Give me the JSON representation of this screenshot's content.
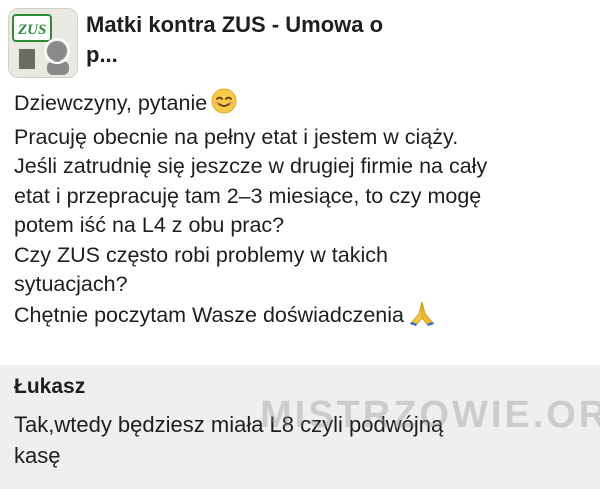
{
  "header": {
    "group_title_line1": "Matki kontra ZUS - Umowa o",
    "group_title_line2": "p..."
  },
  "post": {
    "lines": [
      "Dziewczyny, pytanie",
      "Pracuję obecnie na pełny etat i jestem w ciąży.",
      "Jeśli zatrudnię się jeszcze w drugiej firmie na cały",
      "etat i przepracuję tam 2–3 miesiące, to czy mogę",
      "potem iść na L4 z obu prac?",
      "Czy ZUS często robi problemy w takich",
      "sytuacjach?",
      "Chętnie poczytam Wasze doświadczenia"
    ],
    "icons": [
      "smiling-face-emoji",
      "folded-hands-emoji"
    ]
  },
  "comment": {
    "author": "Łukasz",
    "lines": [
      "Tak,wtedy będziesz miała L8 czyli podwójną",
      "kasę"
    ]
  },
  "watermark": "MISTRZOWIE.ORG",
  "colors": {
    "comment_bg": "#efefef",
    "text": "#1c1e21",
    "emoji_yellow": "#f7c948"
  }
}
